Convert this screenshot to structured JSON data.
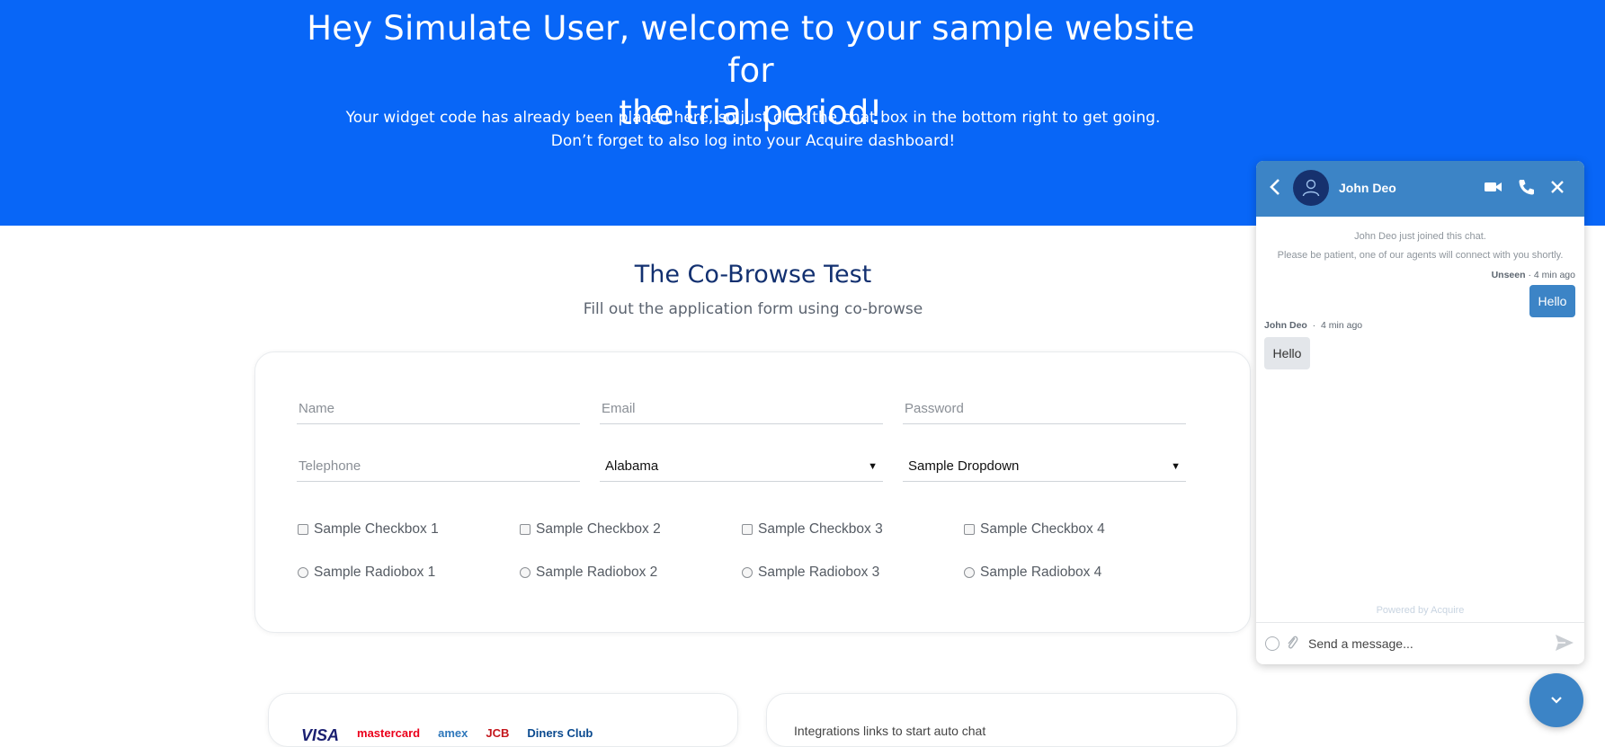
{
  "hero": {
    "title_line1": "Hey Simulate User, welcome to your sample website for",
    "title_line2": "the trial period!",
    "text_line1": "Your widget code has already been placed here, so just click the chat box in the bottom right to get going.",
    "text_line2": "Don’t forget to also log into your Acquire dashboard!"
  },
  "section": {
    "title": "The Co-Browse Test",
    "subtitle": "Fill out the application form using co-browse"
  },
  "form": {
    "name_placeholder": "Name",
    "email_placeholder": "Email",
    "password_placeholder": "Password",
    "telephone_placeholder": "Telephone",
    "state_value": "Alabama",
    "dropdown_value": "Sample Dropdown",
    "checkboxes": [
      "Sample Checkbox 1",
      "Sample Checkbox 2",
      "Sample Checkbox 3",
      "Sample Checkbox 4"
    ],
    "radios": [
      "Sample Radiobox 1",
      "Sample Radiobox 2",
      "Sample Radiobox 3",
      "Sample Radiobox 4"
    ]
  },
  "bottom": {
    "integrations_text": "Integrations links to start auto chat",
    "card_brands": [
      "VISA",
      "mastercard",
      "amex",
      "JCB",
      "Diners Club"
    ]
  },
  "chat": {
    "agent_name": "John Deo",
    "system_joined": "John Deo just joined this chat.",
    "system_wait": "Please be patient, one of our agents will connect with you shortly.",
    "out_status": "Unseen",
    "out_time": "4 min ago",
    "out_message": "Hello",
    "in_sender": "John Deo",
    "in_time": "4 min ago",
    "in_message": "Hello",
    "powered_by": "Powered by Acquire",
    "input_placeholder": "Send a message...",
    "icons": [
      "back-arrow-icon",
      "user-icon",
      "video-camera-icon",
      "phone-icon",
      "close-icon",
      "emoji-icon",
      "paperclip-icon",
      "send-icon",
      "chevron-down-icon"
    ]
  },
  "colors": {
    "hero_bg": "#0866f7",
    "chat_accent": "#3c84c6",
    "title_navy": "#123070"
  }
}
